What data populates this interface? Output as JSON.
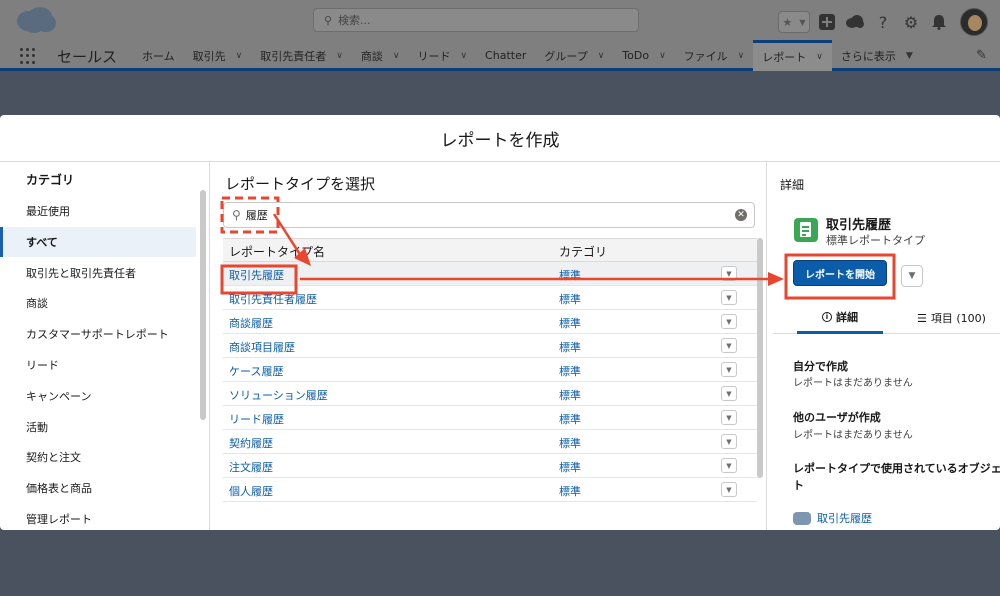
{
  "header": {
    "search_placeholder": "検索...",
    "icons": [
      "star-icon",
      "chevron-down-icon",
      "plus-icon",
      "cloud-icon",
      "help-icon",
      "gear-icon",
      "bell-icon"
    ]
  },
  "nav": {
    "app_name": "セールス",
    "items": [
      {
        "label": "ホーム",
        "dropdown": false
      },
      {
        "label": "取引先",
        "dropdown": true
      },
      {
        "label": "取引先責任者",
        "dropdown": true
      },
      {
        "label": "商談",
        "dropdown": true
      },
      {
        "label": "リード",
        "dropdown": true
      },
      {
        "label": "Chatter",
        "dropdown": false
      },
      {
        "label": "グループ",
        "dropdown": true
      },
      {
        "label": "ToDo",
        "dropdown": true
      },
      {
        "label": "ファイル",
        "dropdown": true
      },
      {
        "label": "レポート",
        "dropdown": true,
        "active": true
      },
      {
        "label": "さらに表示",
        "dropdown": true
      }
    ]
  },
  "modal": {
    "title": "レポートを作成",
    "categories": {
      "title": "カテゴリ",
      "items": [
        "最近使用",
        "すべて",
        "取引先と取引先責任者",
        "商談",
        "カスタマーサポートレポート",
        "リード",
        "キャンペーン",
        "活動",
        "契約と注文",
        "価格表と商品",
        "管理レポート"
      ],
      "selected": "すべて"
    },
    "report_types": {
      "title": "レポートタイプを選択",
      "search_value": "履歴",
      "columns": [
        "レポートタイプ名",
        "カテゴリ"
      ],
      "rows": [
        {
          "name": "取引先履歴",
          "category": "標準"
        },
        {
          "name": "取引先責任者履歴",
          "category": "標準"
        },
        {
          "name": "商談履歴",
          "category": "標準"
        },
        {
          "name": "商談項目履歴",
          "category": "標準"
        },
        {
          "name": "ケース履歴",
          "category": "標準"
        },
        {
          "name": "ソリューション履歴",
          "category": "標準"
        },
        {
          "name": "リード履歴",
          "category": "標準"
        },
        {
          "name": "契約履歴",
          "category": "標準"
        },
        {
          "name": "注文履歴",
          "category": "標準"
        },
        {
          "name": "個人履歴",
          "category": "標準"
        }
      ]
    },
    "details": {
      "title": "詳細",
      "name": "取引先履歴",
      "subtitle": "標準レポートタイプ",
      "start_button": "レポートを開始",
      "tab_details": "詳細",
      "tab_fields": "項目 (100)",
      "created_by_me_heading": "自分で作成",
      "created_by_me_text": "レポートはまだありません",
      "created_by_others_heading": "他のユーザが作成",
      "created_by_others_text": "レポートはまだありません",
      "objects_heading_line1": "レポートタイプで使用されているオブジェ",
      "objects_heading_line2": "ト",
      "object_name": "取引先履歴"
    }
  },
  "colors": {
    "accent": "#0b5cab",
    "annotation_red": "#e8462f",
    "icon_green": "#3ba755"
  }
}
